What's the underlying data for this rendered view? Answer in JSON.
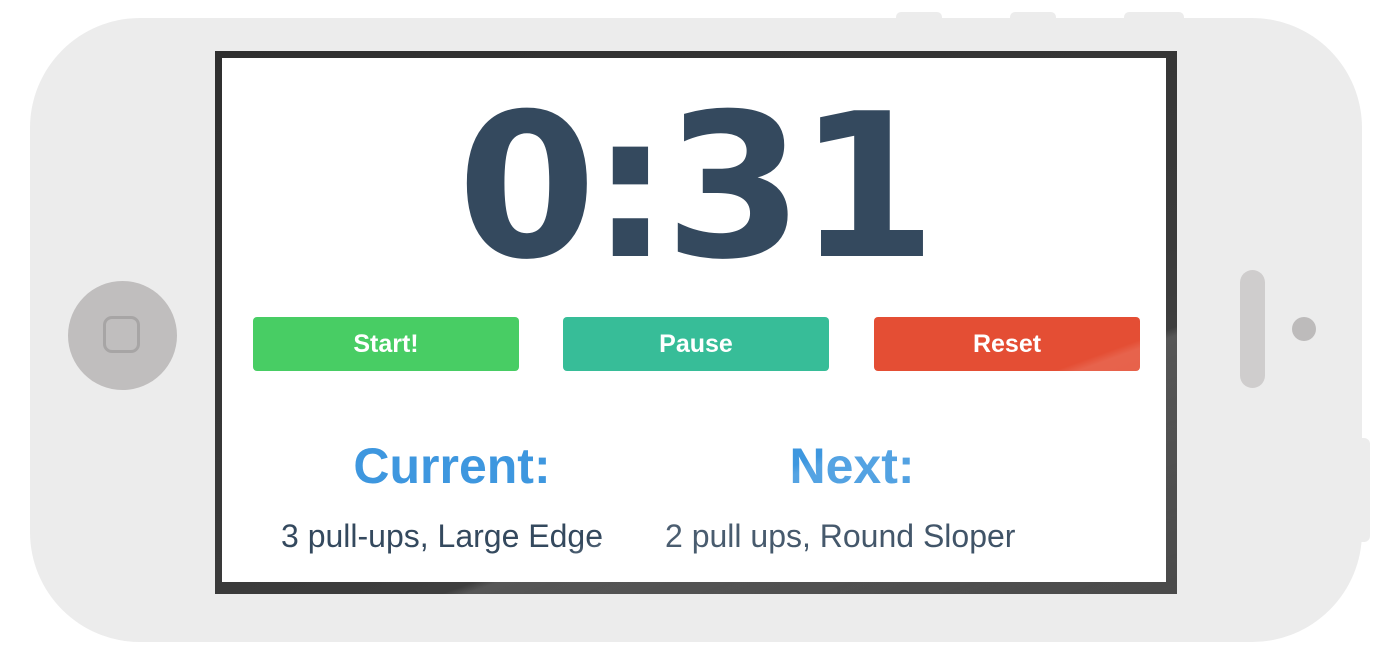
{
  "timer": {
    "display": "0:31"
  },
  "controls": {
    "start_label": "Start!",
    "pause_label": "Pause",
    "reset_label": "Reset",
    "colors": {
      "start": "#48cd64",
      "pause": "#37bd98",
      "reset": "#e44e34"
    }
  },
  "exercise": {
    "current_heading": "Current:",
    "current_value": "3 pull-ups, Large Edge",
    "next_heading": "Next:",
    "next_value": "2 pull ups, Round Sloper"
  },
  "theme": {
    "text_color": "#34495e",
    "heading_color": "#3e97df"
  },
  "device": {
    "icons": [
      "home-button-icon",
      "speaker-icon",
      "camera-icon"
    ]
  }
}
